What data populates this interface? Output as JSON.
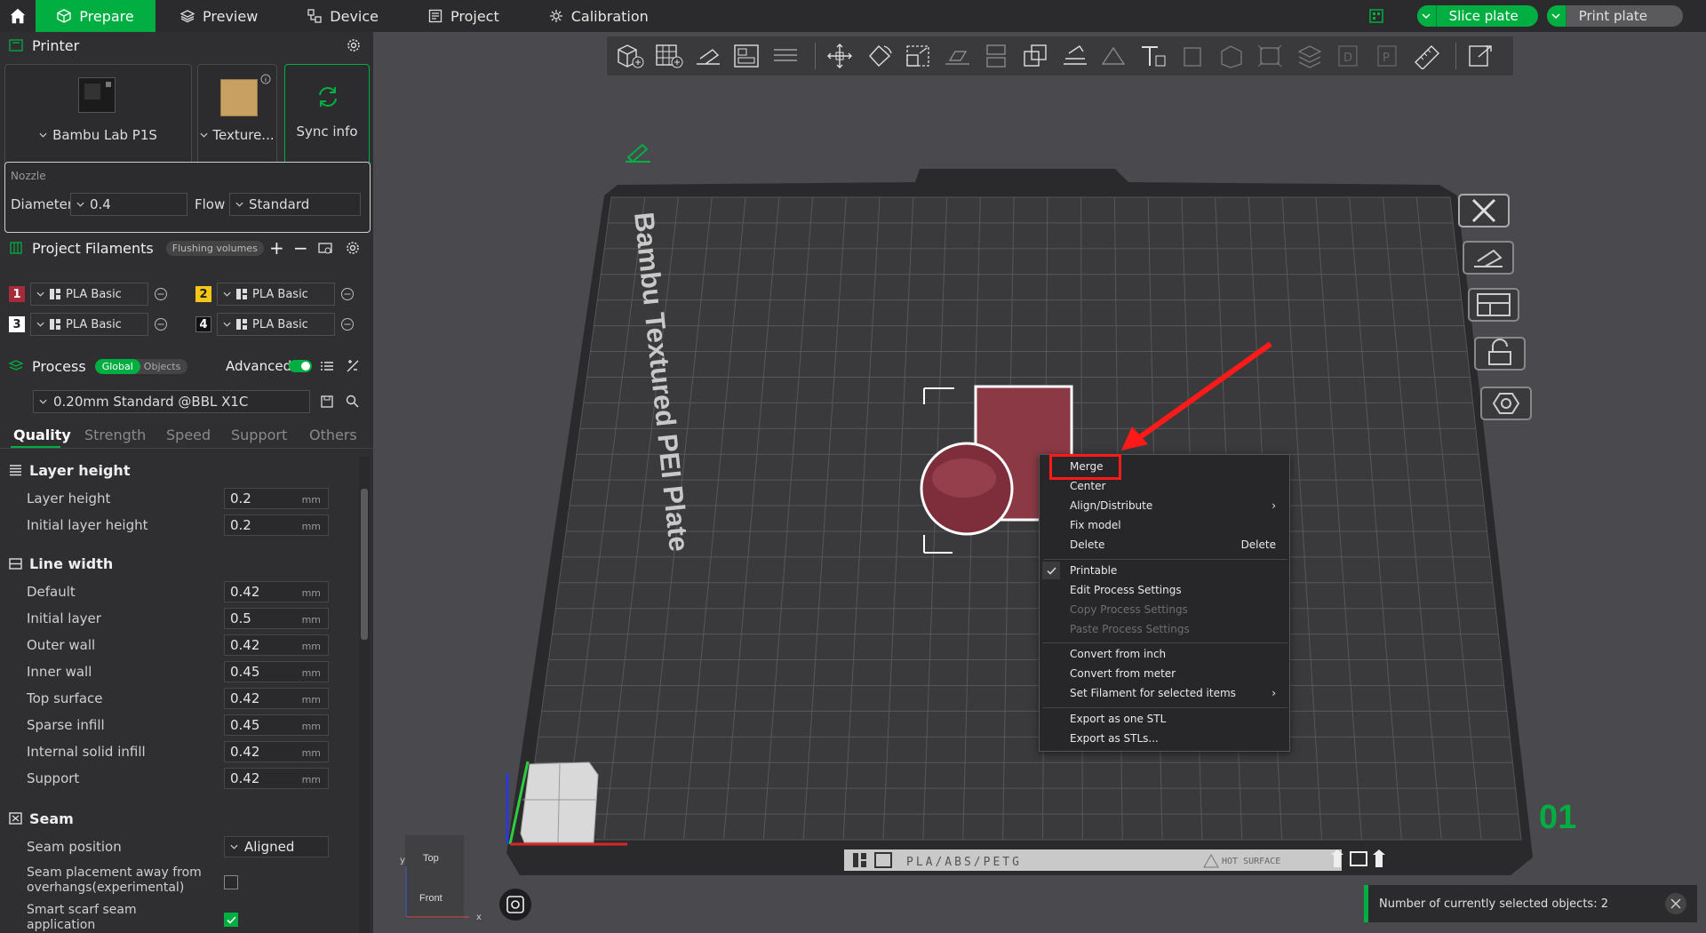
{
  "topbar": {
    "tabs": [
      {
        "label": "Prepare",
        "icon": "cube-icon"
      },
      {
        "label": "Preview",
        "icon": "layers-icon"
      },
      {
        "label": "Device",
        "icon": "device-icon"
      },
      {
        "label": "Project",
        "icon": "project-icon"
      },
      {
        "label": "Calibration",
        "icon": "calibration-icon"
      }
    ],
    "slice_label": "Slice plate",
    "print_label": "Print plate"
  },
  "printer": {
    "title": "Printer",
    "printer_name": "Bambu Lab P1S",
    "plate_name": "Texture...",
    "sync_label": "Sync info",
    "nozzle_title": "Nozzle",
    "diameter_label": "Diameter",
    "diameter_value": "0.4",
    "flow_label": "Flow",
    "flow_value": "Standard"
  },
  "filaments": {
    "title": "Project Filaments",
    "flushing_label": "Flushing volumes",
    "items": [
      {
        "num": "1",
        "name": "PLA Basic",
        "color": "#a52a3a"
      },
      {
        "num": "2",
        "name": "PLA Basic",
        "color": "#f5c518"
      },
      {
        "num": "3",
        "name": "PLA Basic",
        "color": "#ffffff"
      },
      {
        "num": "4",
        "name": "PLA Basic",
        "color": "#111111"
      }
    ]
  },
  "process": {
    "title": "Process",
    "global_label": "Global",
    "objects_label": "Objects",
    "advanced_label": "Advanced",
    "preset": "0.20mm Standard @BBL X1C",
    "tabs": [
      "Quality",
      "Strength",
      "Speed",
      "Support",
      "Others"
    ],
    "active_tab": "Quality"
  },
  "settings": {
    "layer_height_group": "Layer height",
    "layer_height": [
      {
        "label": "Layer height",
        "value": "0.2",
        "unit": "mm"
      },
      {
        "label": "Initial layer height",
        "value": "0.2",
        "unit": "mm"
      }
    ],
    "line_width_group": "Line width",
    "line_width": [
      {
        "label": "Default",
        "value": "0.42",
        "unit": "mm"
      },
      {
        "label": "Initial layer",
        "value": "0.5",
        "unit": "mm"
      },
      {
        "label": "Outer wall",
        "value": "0.42",
        "unit": "mm"
      },
      {
        "label": "Inner wall",
        "value": "0.45",
        "unit": "mm"
      },
      {
        "label": "Top surface",
        "value": "0.42",
        "unit": "mm"
      },
      {
        "label": "Sparse infill",
        "value": "0.45",
        "unit": "mm"
      },
      {
        "label": "Internal solid infill",
        "value": "0.42",
        "unit": "mm"
      },
      {
        "label": "Support",
        "value": "0.42",
        "unit": "mm"
      }
    ],
    "seam_group": "Seam",
    "seam_position_label": "Seam position",
    "seam_position_value": "Aligned",
    "seam_away_label": "Seam placement away from overhangs(experimental)",
    "smart_scarf_label": "Smart scarf seam application"
  },
  "plate": {
    "name_text": "Bambu Textured PEI Plate",
    "number": "01",
    "bottom_text": "PLA/ABS/PETG",
    "hot_surface": "HOT SURFACE"
  },
  "axes": {
    "top_label": "Top",
    "front_label": "Front",
    "x": "x",
    "y": "y"
  },
  "context_menu": {
    "items": [
      {
        "label": "Merge",
        "shortcut": "",
        "disabled": false
      },
      {
        "label": "Center",
        "shortcut": "",
        "disabled": false
      },
      {
        "label": "Align/Distribute",
        "shortcut": "›",
        "disabled": false
      },
      {
        "label": "Fix model",
        "shortcut": "",
        "disabled": false
      },
      {
        "label": "Delete",
        "shortcut": "Delete",
        "disabled": false
      },
      {
        "label": "Printable",
        "shortcut": "",
        "disabled": false
      },
      {
        "label": "Edit Process Settings",
        "shortcut": "",
        "disabled": false
      },
      {
        "label": "Copy Process Settings",
        "shortcut": "",
        "disabled": true
      },
      {
        "label": "Paste Process Settings",
        "shortcut": "",
        "disabled": true
      },
      {
        "label": "Convert from inch",
        "shortcut": "",
        "disabled": false
      },
      {
        "label": "Convert from meter",
        "shortcut": "",
        "disabled": false
      },
      {
        "label": "Set Filament for selected items",
        "shortcut": "›",
        "disabled": false
      },
      {
        "label": "Export as one STL",
        "shortcut": "",
        "disabled": false
      },
      {
        "label": "Export as STLs...",
        "shortcut": "",
        "disabled": false
      }
    ]
  },
  "status": {
    "notification": "Number of currently selected objects: 2"
  },
  "colors": {
    "accent": "#00ae42",
    "highlight": "#ff1a1a",
    "model": "#8b3a45"
  }
}
